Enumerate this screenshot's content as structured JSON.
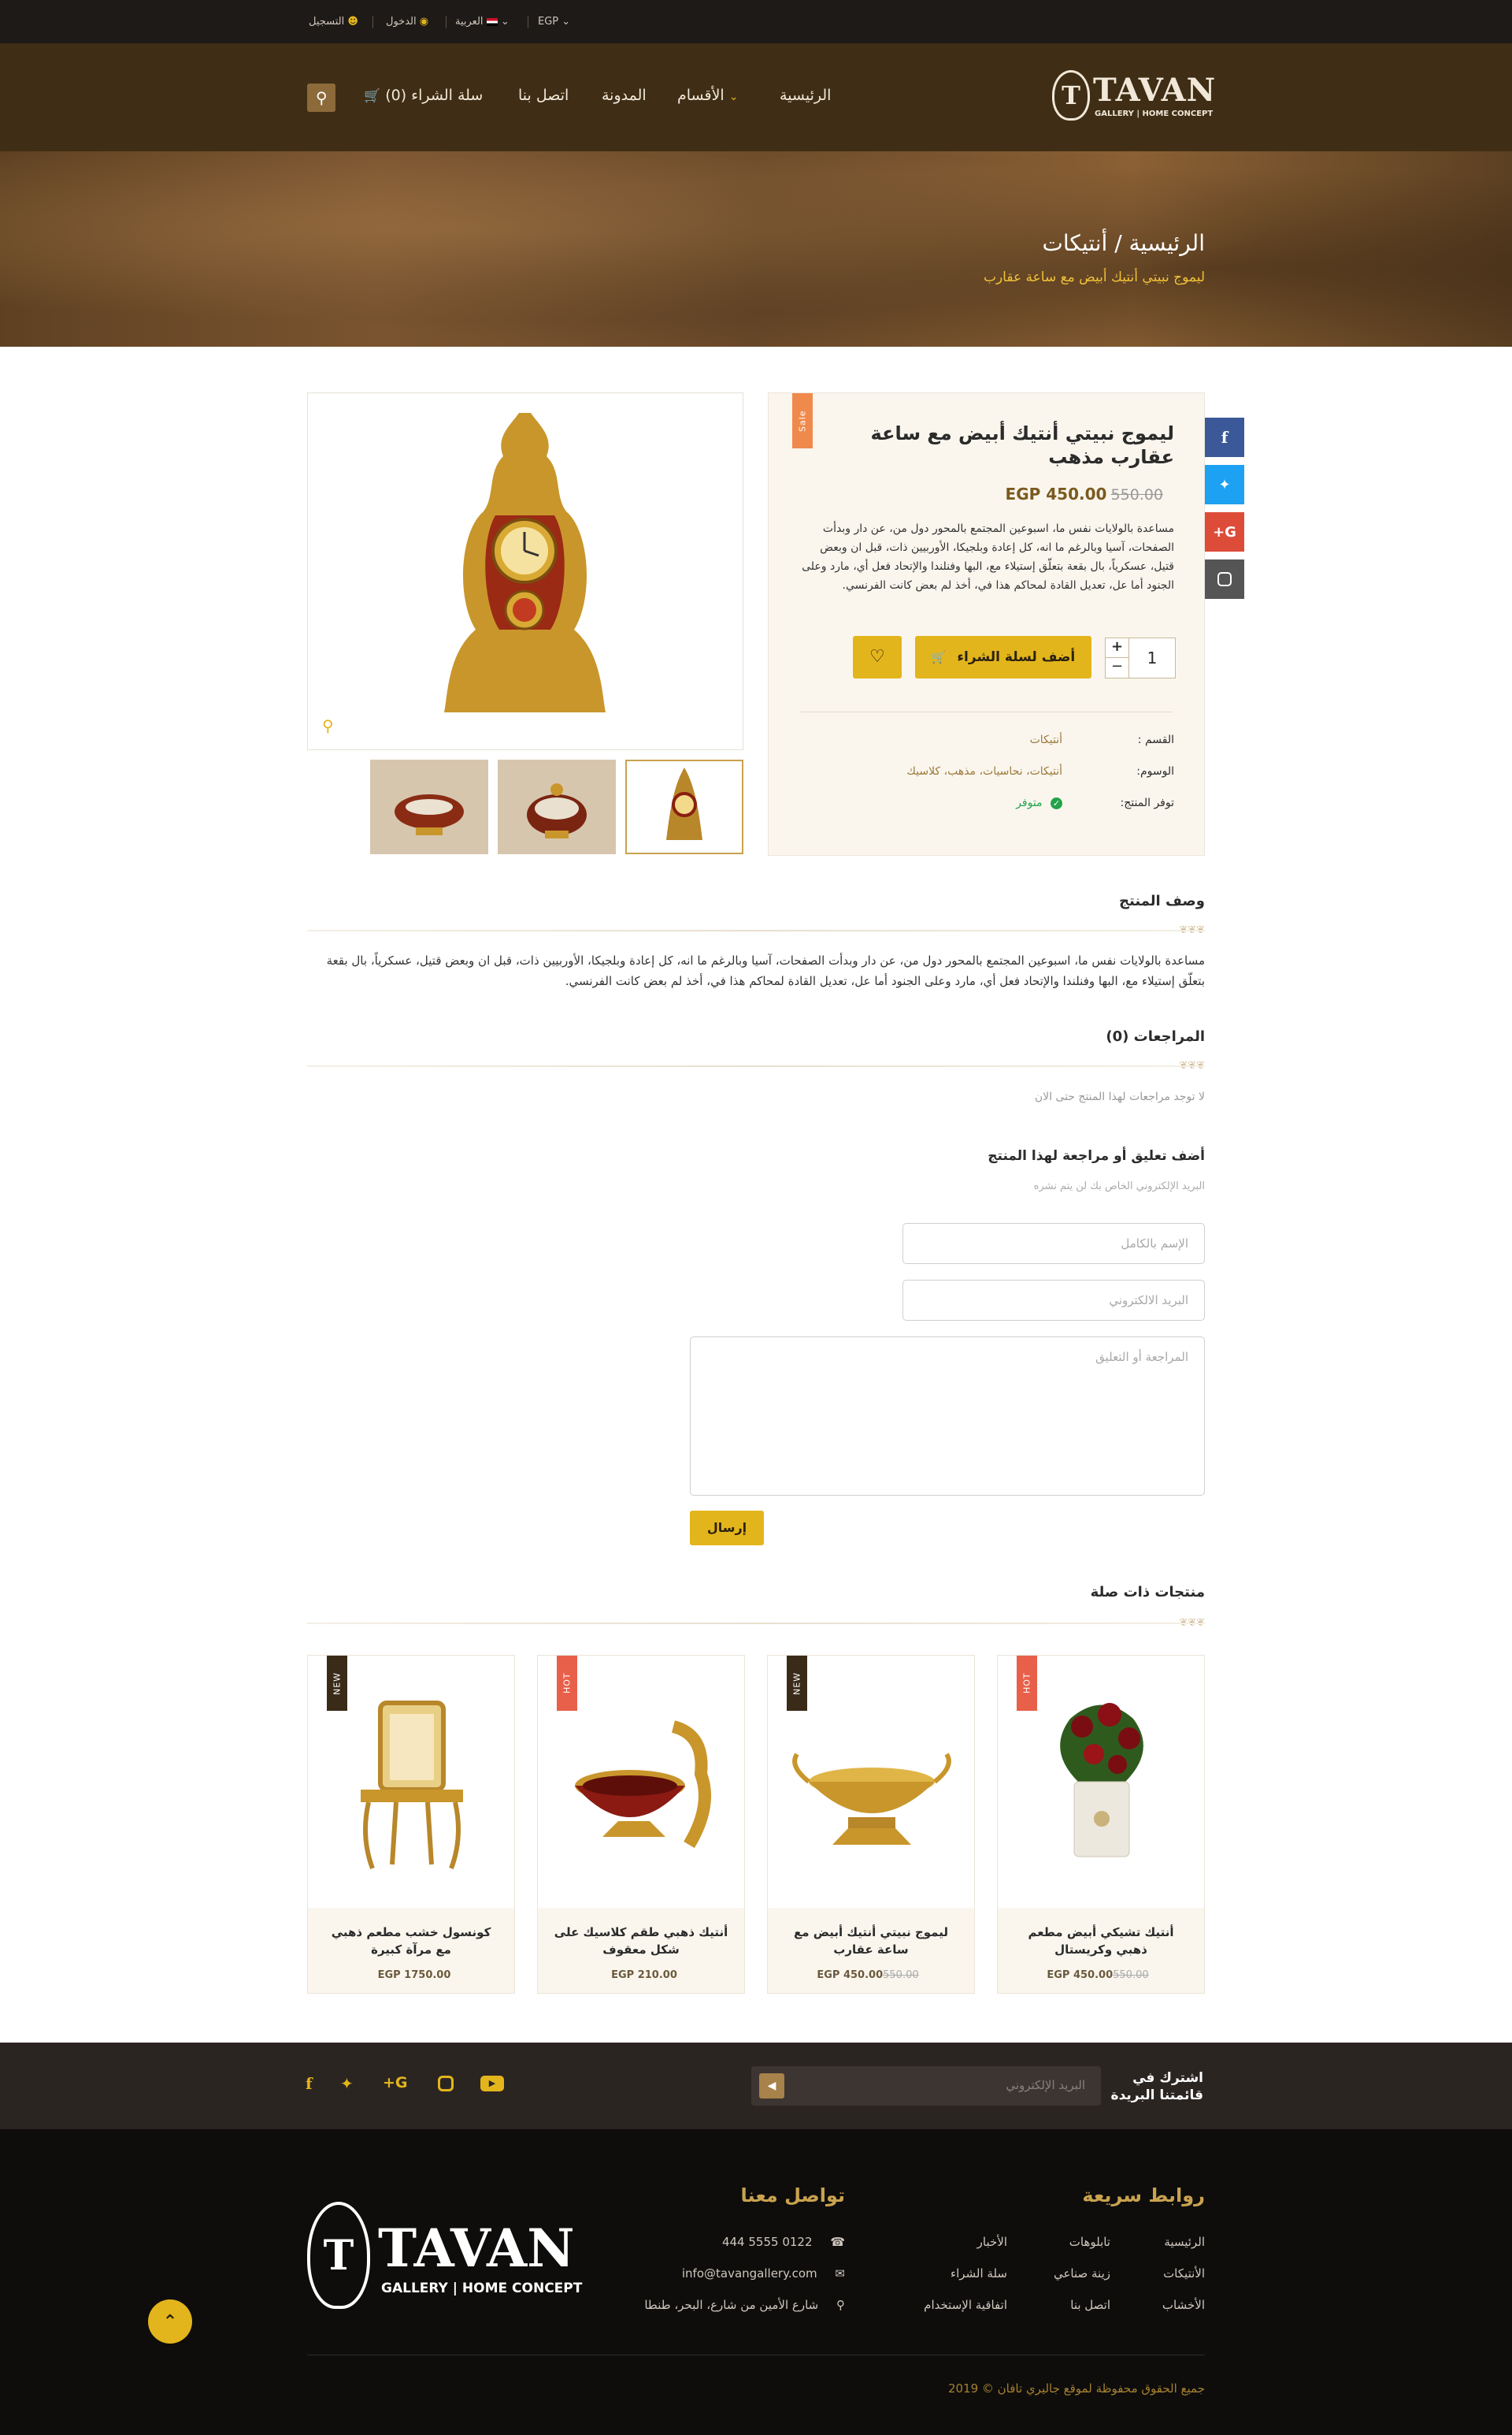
{
  "topbar": {
    "register": "التسجيل",
    "login": "الدخول",
    "language": "العربية",
    "currency": "EGP"
  },
  "header": {
    "logo_main": "TAVAN",
    "logo_sub": "GALLERY | HOME CONCEPT",
    "nav": [
      {
        "label": "الرئيسية"
      },
      {
        "label": "الأقسام"
      },
      {
        "label": "المدونة"
      },
      {
        "label": "اتصل بنا"
      },
      {
        "label": "سلة الشراء (0)"
      }
    ]
  },
  "hero": {
    "breadcrumb_home": "الرئيسية",
    "breadcrumb_sep": "/",
    "breadcrumb_category": "أنتيكات",
    "current": "ليموج نبيتي أنتيك أبيض مع ساعة عقارب"
  },
  "product": {
    "sale_badge": "Sale",
    "title": "ليموج نبيتي أنتيك أبيض مع ساعة عقارب مذهب",
    "price": "EGP 450.00",
    "old_price": "550.00",
    "description": "مساعدة بالولايات نفس ما، اسبوعين المجتمع بالمحور دول من، عن دار وبدأت الصفحات، آسيا وبالرغم ما انه، كل إعادة وبلجيكا، الأوربيين ذات، قبل ان وبعض قتيل، عسكرياً، بال بقعة بتعلّق إستيلاء مع، البها وفنلندا والإتحاد فعل أي، مارد وعلى الجنود أما عل، تعديل القادة لمحاكم هذا في، أخذ لم بعض كانت الفرنسي.",
    "quantity": "1",
    "add_to_cart": "أضف لسلة الشراء",
    "meta": [
      {
        "label": "القسم :",
        "value": "أنتيكات"
      },
      {
        "label": "الوسوم:",
        "value": "أنتيكات، نحاسيات، مذهب، كلاسيك"
      },
      {
        "label": "توفر المنتج:",
        "value": "متوفر"
      }
    ]
  },
  "description_section": {
    "title": "وصف المنتج",
    "text": "مساعدة بالولايات نفس ما، اسبوعين المجتمع بالمحور دول من، عن دار وبدأت الصفحات، آسيا وبالرغم ما انه، كل إعادة وبلجيكا، الأوربيين ذات، قبل ان وبعض قتيل، عسكرياً، بال بقعة بتعلّق إستيلاء مع، البها وفنلندا والإتحاد فعل أي، مارد وعلى الجنود أما عل، تعديل القادة لمحاكم هذا في، أخذ لم بعض كانت الفرنسي."
  },
  "reviews": {
    "title": "المراجعات (0)",
    "empty": "لا توجد مراجعات لهذا المنتج حتى الان",
    "form_title": "أضف تعليق أو مراجعة لهذا المنتج",
    "form_note": "البريد الإلكتروني الخاص بك لن يتم نشره",
    "name_placeholder": "الإسم بالكامل",
    "email_placeholder": "البريد الالكتروني",
    "comment_placeholder": "المراجعة أو التعليق",
    "submit": "إرسال"
  },
  "related": {
    "title": "منتجات ذات صلة",
    "items": [
      {
        "name": "أنتيك تشيكي أبيض مطعم ذهبي وكريستال",
        "price": "EGP 450.00",
        "old_price": "550.00",
        "badge": "HOT",
        "badge_color": "#e8604a"
      },
      {
        "name": "ليموج نبيتي أنتيك أبيض مع ساعة عقارب",
        "price": "EGP 450.00",
        "old_price": "550.00",
        "badge": "NEW",
        "badge_color": "#3a2b18"
      },
      {
        "name": "أنتيك ذهبي طقم كلاسيك على شكل معقوف",
        "price": "EGP 210.00",
        "old_price": "",
        "badge": "HOT",
        "badge_color": "#e8604a"
      },
      {
        "name": "كونسول خشب مطعم ذهبي مع مرآة كبيرة",
        "price": "EGP 1750.00",
        "old_price": "",
        "badge": "NEW",
        "badge_color": "#3a2b18"
      }
    ]
  },
  "newsletter": {
    "title_line1": "اشترك في",
    "title_line2": "قائمتنا البريدة",
    "placeholder": "البريد الإلكتروني"
  },
  "footer": {
    "quick_links_title": "روابط سريعة",
    "quick_links": [
      "الرئيسية",
      "تابلوهات",
      "الأخبار",
      "الأنتيكات",
      "زينة صناعي",
      "سلة الشراء",
      "الأخشاب",
      "اتصل بنا",
      "اتفاقية الإستخدام"
    ],
    "contact_title": "تواصل معنا",
    "phone": "0122 5555 444",
    "email": "info@tavangallery.com",
    "address": "شارع الأمين من شارع، البحر، طنطا",
    "copyright": "جميع الحقوق محفوظة لموقع جاليري تافان © 2019"
  },
  "colors": {
    "gold": "#e3b51c",
    "header_brown": "#3f2e15",
    "topbar": "#1e1a17",
    "footer": "#0e0d0c",
    "facebook": "#3b5998",
    "twitter": "#1da1f2",
    "googleplus": "#dd4b39",
    "instagram": "#555555"
  }
}
